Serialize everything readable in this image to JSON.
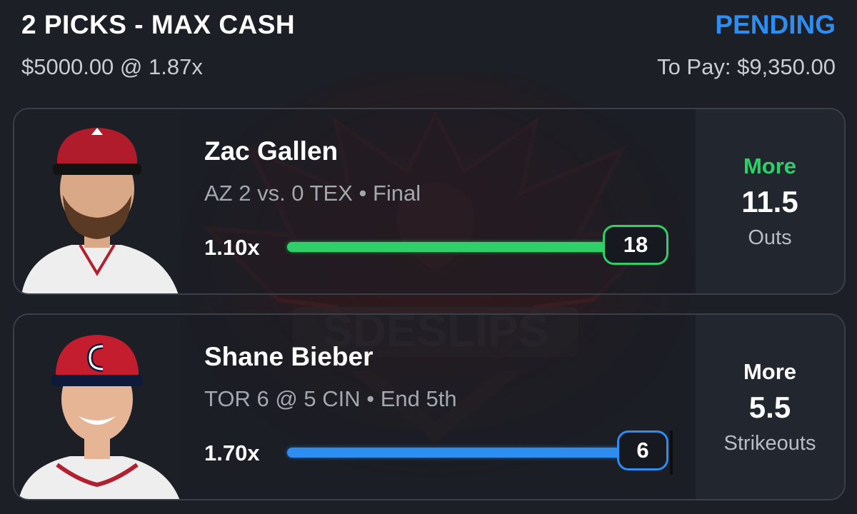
{
  "header": {
    "title": "2 PICKS - MAX CASH",
    "status": "PENDING",
    "stake": "$5000.00 @ 1.87x",
    "to_pay": "To Pay: $9,350.00"
  },
  "watermark_text": "SDESLIPS",
  "colors": {
    "accent_blue": "#2d8df0",
    "win_green": "#2fd069",
    "background": "#1c1f26"
  },
  "picks": [
    {
      "player": "Zac Gallen",
      "game": "AZ 2 vs. 0 TEX • Final",
      "multiplier": "1.10x",
      "current_value": "18",
      "progress": 1.0,
      "direction": "More",
      "line": "11.5",
      "stat": "Outs",
      "state": "won"
    },
    {
      "player": "Shane Bieber",
      "game": "TOR 6 @ 5 CIN • End 5th",
      "multiplier": "1.70x",
      "current_value": "6",
      "progress": 1.0,
      "direction": "More",
      "line": "5.5",
      "stat": "Strikeouts",
      "state": "live"
    }
  ]
}
